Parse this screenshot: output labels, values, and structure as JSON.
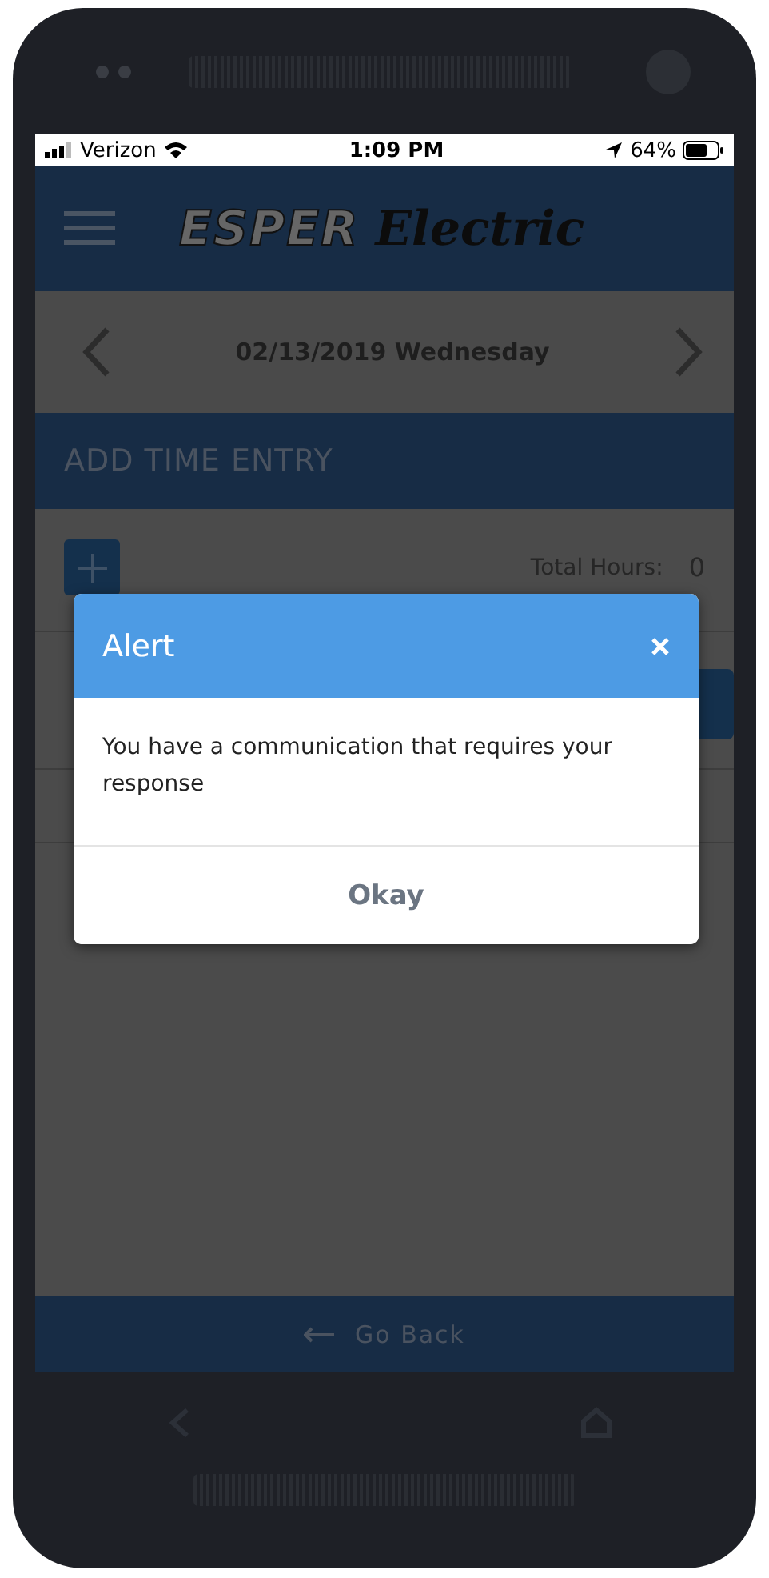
{
  "status_bar": {
    "carrier": "Verizon",
    "time": "1:09 PM",
    "battery": "64%"
  },
  "header": {
    "logo_word_1": "ESPER",
    "logo_word_2": "Electric"
  },
  "date_nav": {
    "date": "02/13/2019 Wednesday"
  },
  "section": {
    "title": "ADD TIME ENTRY"
  },
  "summary": {
    "total_label": "Total Hours:",
    "total_value": "0"
  },
  "alert": {
    "title": "Alert",
    "message": "You have a communication that requires your response",
    "button": "Okay"
  },
  "footer": {
    "back_label": "Go Back"
  }
}
